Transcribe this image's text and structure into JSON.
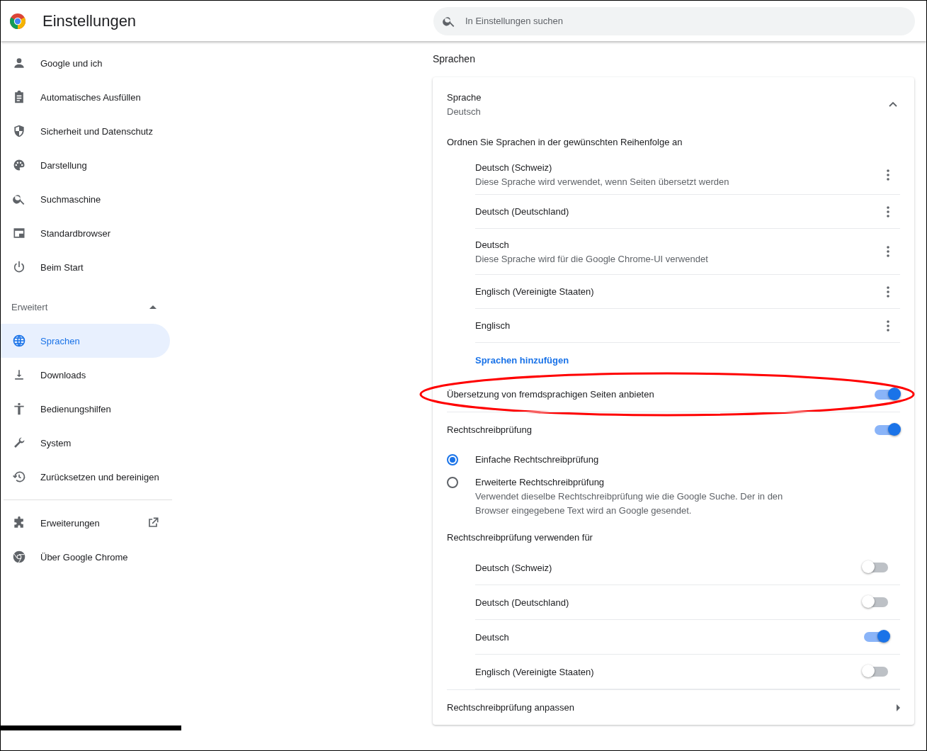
{
  "header": {
    "title": "Einstellungen",
    "search": {
      "placeholder": "In Einstellungen suchen"
    }
  },
  "sidebar": {
    "items": [
      {
        "label": "Google und ich",
        "selected": false
      },
      {
        "label": "Automatisches Ausfüllen",
        "selected": false
      },
      {
        "label": "Sicherheit und Datenschutz",
        "selected": false
      },
      {
        "label": "Darstellung",
        "selected": false
      },
      {
        "label": "Suchmaschine",
        "selected": false
      },
      {
        "label": "Standardbrowser",
        "selected": false
      },
      {
        "label": "Beim Start",
        "selected": false
      }
    ],
    "advanced": {
      "label": "Erweitert",
      "expanded": true,
      "items": [
        {
          "label": "Sprachen",
          "selected": true
        },
        {
          "label": "Downloads",
          "selected": false
        },
        {
          "label": "Bedienungshilfen",
          "selected": false
        },
        {
          "label": "System",
          "selected": false
        },
        {
          "label": "Zurücksetzen und bereinigen",
          "selected": false
        }
      ]
    },
    "footer_items": [
      {
        "label": "Erweiterungen"
      },
      {
        "label": "Über Google Chrome"
      }
    ]
  },
  "section_title": "Sprachen",
  "language": {
    "label": "Sprache",
    "value": "Deutsch",
    "expanded": true,
    "order_label": "Ordnen Sie Sprachen in der gewünschten Reihenfolge an",
    "languages": [
      {
        "name": "Deutsch (Schweiz)",
        "note": "Diese Sprache wird verwendet, wenn Seiten übersetzt werden"
      },
      {
        "name": "Deutsch (Deutschland)"
      },
      {
        "name": "Deutsch",
        "note": "Diese Sprache wird für die Google Chrome-UI verwendet"
      },
      {
        "name": "Englisch (Vereinigte Staaten)"
      },
      {
        "name": "Englisch"
      }
    ],
    "add_link": "Sprachen hinzufügen"
  },
  "translate": {
    "label": "Übersetzung von fremdsprachigen Seiten anbieten",
    "on": true
  },
  "spellcheck": {
    "label": "Rechtschreibprüfung",
    "on": true,
    "options": [
      {
        "label": "Einfache Rechtschreibprüfung",
        "selected": true
      },
      {
        "label": "Erweiterte Rechtschreibprüfung",
        "description": "Verwendet dieselbe Rechtschreibprüfung wie die Google Suche. Der in den Browser eingegebene Text wird an Google gesendet.",
        "selected": false
      }
    ],
    "use_for_label": "Rechtschreibprüfung verwenden für",
    "languages": [
      {
        "name": "Deutsch (Schweiz)",
        "on": false
      },
      {
        "name": "Deutsch (Deutschland)",
        "on": false
      },
      {
        "name": "Deutsch",
        "on": true
      },
      {
        "name": "Englisch (Vereinigte Staaten)",
        "on": false
      }
    ],
    "customize": "Rechtschreibprüfung anpassen"
  }
}
